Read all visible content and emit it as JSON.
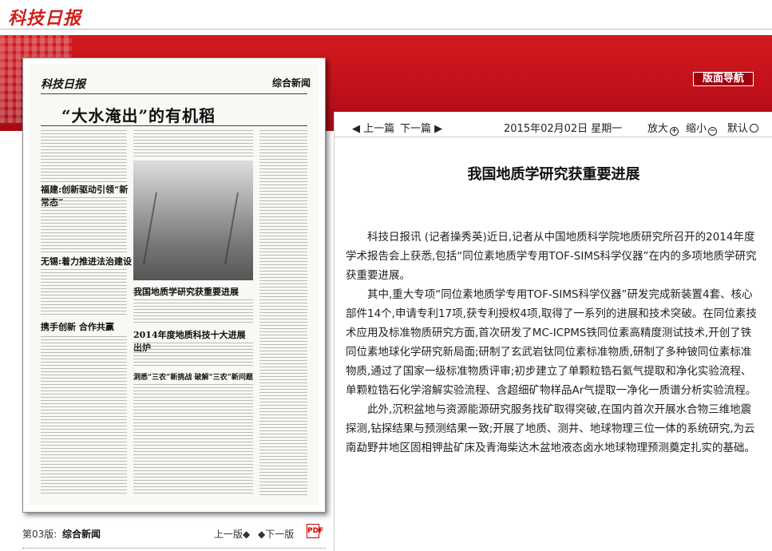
{
  "header": {
    "logo_text": "科技日报",
    "nav_button": "版面导航"
  },
  "paper": {
    "masthead": "科技日报",
    "section_tag": "综合新闻",
    "headline": "“大水淹出”的有机稻",
    "subheads": [
      "福建:创新驱动引领“新常态”",
      "无锡:着力推进法治建设",
      "携手创新 合作共赢",
      "我国地质学研究获重要进展",
      "2014年度地质科技十大进展出炉",
      "洞悉“三农”新挑战 破解“三农”新问题"
    ]
  },
  "paper_footer": {
    "page_label": "第03版:",
    "page_name": "综合新闻",
    "prev": "上一版◆",
    "next": "◆下一版",
    "pdf": "PDF"
  },
  "toolbar": {
    "prev_article": "◀ 上一篇",
    "next_article": "下一篇 ▶",
    "date": "2015年02月02日  星期一",
    "zoom_in": "放大",
    "zoom_out": "缩小",
    "zoom_default": "默认"
  },
  "article": {
    "title": "我国地质学研究获重要进展",
    "paragraphs": [
      "科技日报讯 (记者操秀英)近日,记者从中国地质科学院地质研究所召开的2014年度学术报告会上获悉,包括“同位素地质学专用TOF-SIMS科学仪器”在内的多项地质学研究获重要进展。",
      "其中,重大专项“同位素地质学专用TOF-SIMS科学仪器”研发完成新装置4套、核心部件14个,申请专利17项,获专利授权4项,取得了一系列的进展和技术突破。在同位素技术应用及标准物质研究方面,首次研发了MC-ICPMS铁同位素高精度测试技术,开创了铁同位素地球化学研究新局面;研制了玄武岩钛同位素标准物质,研制了多种铍同位素标准物质,通过了国家一级标准物质评审;初步建立了单颗粒锆石氦气提取和净化实验流程、单颗粒锆石化学溶解实验流程、含超细矿物样品Ar气提取一净化一质谱分析实验流程。",
      "此外,沉积盆地与资源能源研究服务找矿取得突破,在国内首次开展水合物三维地震探测,钻探结果与预测结果一致;开展了地质、测井、地球物理三位一体的系统研究,为云南勐野井地区固相钾盐矿床及青海柴达木盆地液态卤水地球物理预测奠定扎实的基础。"
    ]
  }
}
